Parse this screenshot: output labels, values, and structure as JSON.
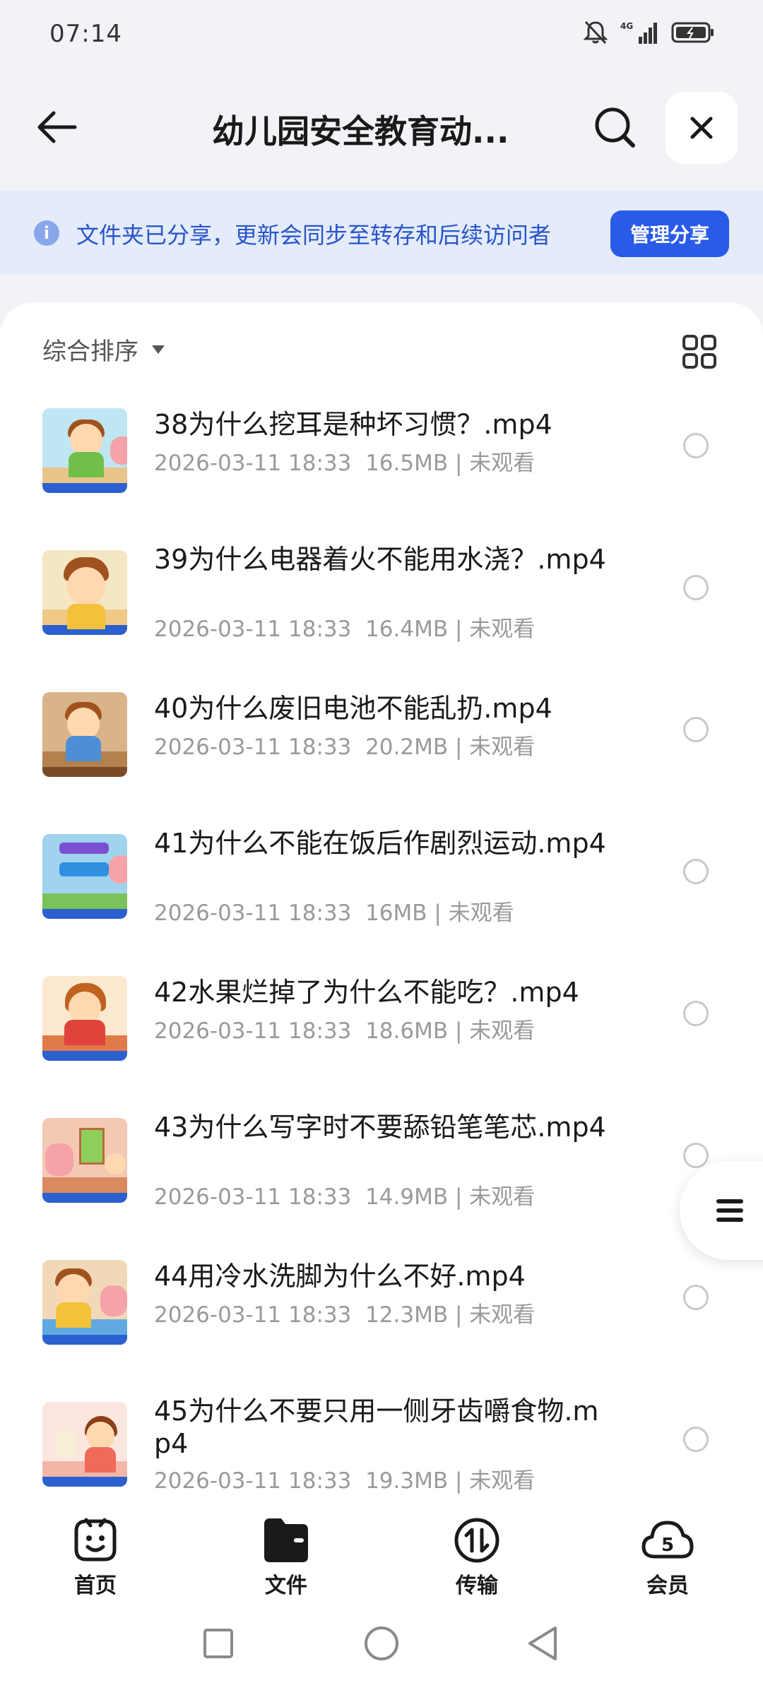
{
  "status_bar": {
    "time": "07:14",
    "network": "4G"
  },
  "header": {
    "title": "幼儿园安全教育动..."
  },
  "banner": {
    "text": "文件夹已分享，更新会同步至转存和后续访问者",
    "button_label": "管理分享"
  },
  "toolbar": {
    "sort_label": "综合排序"
  },
  "files": [
    {
      "name": "38为什么挖耳是种坏习惯？.mp4",
      "date": "2026-03-11 18:33",
      "size": "16.5MB",
      "status": "未观看"
    },
    {
      "name": "39为什么电器着火不能用水浇？.mp4",
      "date": "2026-03-11 18:33",
      "size": "16.4MB",
      "status": "未观看"
    },
    {
      "name": "40为什么废旧电池不能乱扔.mp4",
      "date": "2026-03-11 18:33",
      "size": "20.2MB",
      "status": "未观看"
    },
    {
      "name": "41为什么不能在饭后作剧烈运动.mp4",
      "date": "2026-03-11 18:33",
      "size": "16MB",
      "status": "未观看"
    },
    {
      "name": "42水果烂掉了为什么不能吃？.mp4",
      "date": "2026-03-11 18:33",
      "size": "18.6MB",
      "status": "未观看"
    },
    {
      "name": "43为什么写字时不要舔铅笔笔芯.mp4",
      "date": "2026-03-11 18:33",
      "size": "14.9MB",
      "status": "未观看"
    },
    {
      "name": "44用冷水洗脚为什么不好.mp4",
      "date": "2026-03-11 18:33",
      "size": "12.3MB",
      "status": "未观看"
    },
    {
      "name": "45为什么不要只用一侧牙齿嚼食物.mp4",
      "date": "2026-03-11 18:33",
      "size": "19.3MB",
      "status": "未观看"
    }
  ],
  "bottom_nav": [
    {
      "label": "首页",
      "icon": "smile-face-icon"
    },
    {
      "label": "文件",
      "icon": "folder-icon"
    },
    {
      "label": "传输",
      "icon": "transfer-icon"
    },
    {
      "label": "会员",
      "icon": "membership-cloud-icon"
    }
  ],
  "colors": {
    "accent": "#2a5ae8",
    "banner_bg": "#e4ebfb",
    "banner_text": "#2a55c9",
    "meta_text": "#9a9a9a"
  }
}
